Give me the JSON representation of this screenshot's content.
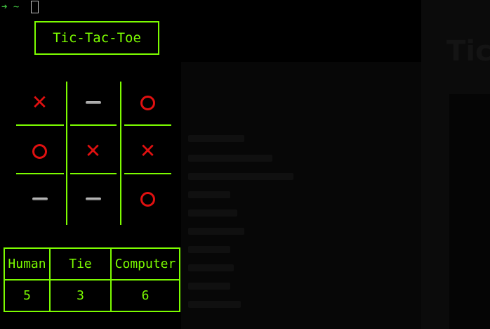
{
  "terminal": {
    "prompt": "➜ ~"
  },
  "game": {
    "title": "Tic-Tac-Toe",
    "board": [
      [
        "X",
        "",
        "O"
      ],
      [
        "O",
        "X",
        "X"
      ],
      [
        "",
        "",
        "O"
      ]
    ]
  },
  "score": {
    "headers": [
      "Human",
      "Tie",
      "Computer"
    ],
    "values": [
      "5",
      "3",
      "6"
    ]
  },
  "colors": {
    "accent": "#7cfc00",
    "mark": "#e01010",
    "background": "#000000"
  }
}
